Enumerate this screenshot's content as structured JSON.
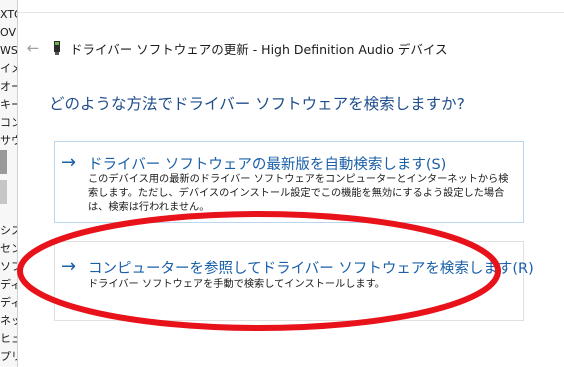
{
  "background_window": {
    "items": [
      "XTO",
      "OVD",
      "WS",
      "イメ",
      "オー",
      "キー",
      "コン",
      "サウ",
      "",
      "",
      "",
      "",
      "シス",
      "セン",
      "ソフ",
      "ディ",
      "ディ",
      "ネッ",
      "ヒュ",
      "プリ"
    ]
  },
  "dialog": {
    "back_label": "←",
    "title": "ドライバー ソフトウェアの更新 - High Definition Audio デバイス",
    "question": "どのような方法でドライバー ソフトウェアを検索しますか?",
    "options": [
      {
        "arrow": "→",
        "title": "ドライバー ソフトウェアの最新版を自動検索します(S)",
        "description": "このデバイス用の最新のドライバー ソフトウェアをコンピューターとインターネットから検索します。ただし、デバイスのインストール設定でこの機能を無効にするよう設定した場合は、検索は行われません。"
      },
      {
        "arrow": "→",
        "title": "コンピューターを参照してドライバー ソフトウェアを検索します(R)",
        "description": "ドライバー ソフトウェアを手動で検索してインストールします。"
      }
    ]
  },
  "colors": {
    "link_blue": "#1a5fa8",
    "question_blue": "#1f4e8c",
    "highlight_red": "#e8121a"
  },
  "icons": {
    "back": "back-arrow-icon",
    "device": "device-icon",
    "option_arrow": "right-arrow-icon"
  }
}
